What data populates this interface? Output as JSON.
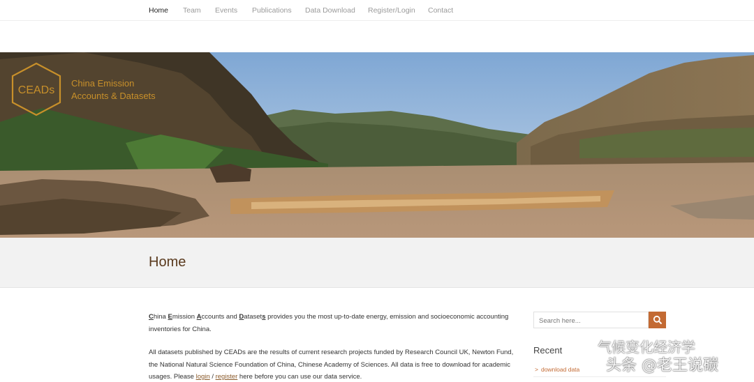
{
  "nav": {
    "items": [
      "Home",
      "Team",
      "Events",
      "Publications",
      "Data Download",
      "Register/Login",
      "Contact"
    ],
    "active": "Home"
  },
  "banner": {
    "logo_mark": "CEADs",
    "logo_line1": "China Emission",
    "logo_line2": "Accounts & Datasets"
  },
  "page": {
    "title": "Home"
  },
  "intro": {
    "c": "C",
    "hina": "hina ",
    "e": "E",
    "mission": "mission ",
    "a": "A",
    "ccounts_and": "ccounts and ",
    "d": "D",
    "ataset": "ataset",
    "s": "s",
    "rest": " provides you the most up-to-date energy, emission and socioeconomic accounting inventories for China."
  },
  "datasets_paragraph": {
    "text": "All datasets published by CEADs are the results of current research projects funded by Research Council UK, Newton Fund, the National Natural Science Foundation of China, Chinese Academy of Sciences. All data is free to download for academic usages. Please ",
    "login": "login",
    "sep": " / ",
    "register": "register",
    "after": " here before you can use our data service."
  },
  "sidebar": {
    "search_placeholder": "Search here...",
    "recent_title": "Recent",
    "recent_items": [
      "download data"
    ]
  },
  "watermark": {
    "line1": "气候变化经济学",
    "line2": "头条 @老王说碳"
  },
  "colors": {
    "accent": "#c36a33",
    "logo_gold": "#c8902a",
    "title_brown": "#5a3a1e"
  }
}
